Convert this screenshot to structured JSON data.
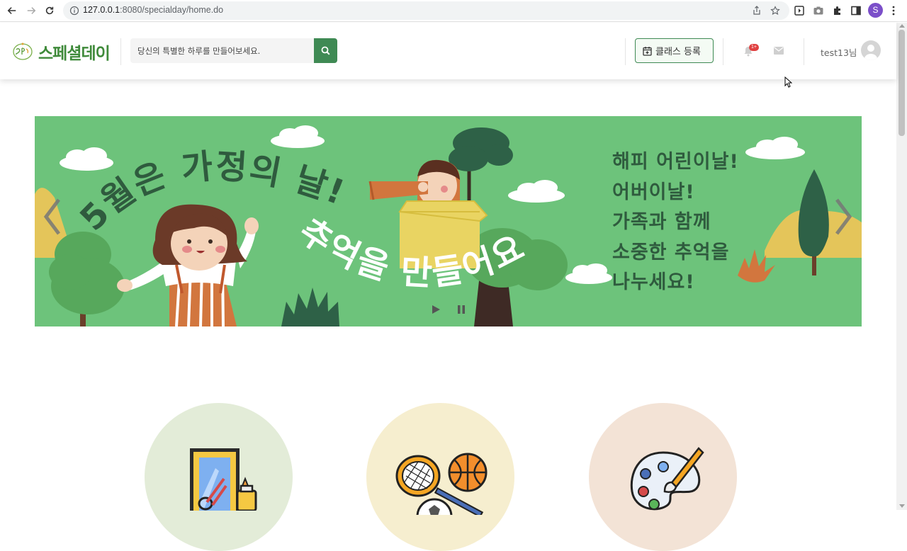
{
  "browser": {
    "url_host": "127.0.0.1",
    "url_path": ":8080/specialday/home.do",
    "profile_initial": "S"
  },
  "header": {
    "logo_text": "스페셜데이",
    "search_placeholder": "당신의 특별한 하루를 만들어보세요.",
    "class_button_label": "클래스 등록",
    "notification_badge": "1+",
    "user_name": "test13님"
  },
  "banner": {
    "headline_arc": "5월은 가정의 날!",
    "headline_lower": "추억을 만들어요",
    "right_lines": [
      "해피 어린이날!",
      "어버이날!",
      "가족과 함께",
      "소중한 추억을",
      "나누세요!"
    ],
    "colors": {
      "background": "#6dc37b",
      "text_dark": "#2f5b3e"
    }
  },
  "categories": [
    {
      "icon": "craft-icon",
      "circle_color": "#e3ecd8"
    },
    {
      "icon": "sports-icon",
      "circle_color": "#f6eecf"
    },
    {
      "icon": "art-palette-icon",
      "circle_color": "#f3e3d6"
    }
  ],
  "colors": {
    "brand_green": "#3f8a54",
    "logo_green": "#3f8a3a"
  }
}
